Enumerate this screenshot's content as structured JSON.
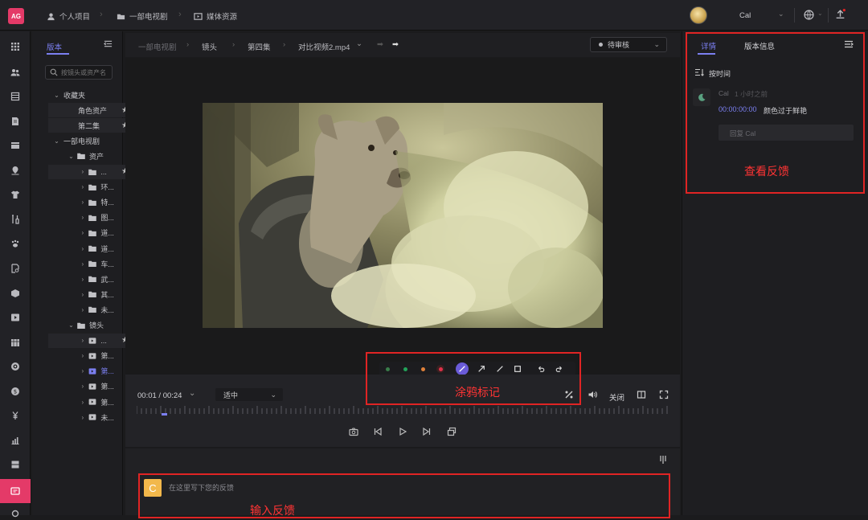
{
  "header": {
    "logo": "AG",
    "breadcrumb": [
      {
        "label": "个人项目",
        "icon": "person-icon"
      },
      {
        "label": "一部电视剧",
        "icon": "folder-icon"
      },
      {
        "label": "媒体资源",
        "icon": "media-icon"
      }
    ],
    "user_name": "Cal"
  },
  "tree": {
    "tab_label": "版本",
    "search_placeholder": "按镜头或资产名",
    "items": [
      {
        "label": "收藏夹",
        "level": 0,
        "chevron": "down"
      },
      {
        "label": "角色资产",
        "level": 1,
        "star": true
      },
      {
        "label": "第二集",
        "level": 1,
        "star": true
      },
      {
        "label": "一部电视剧",
        "level": 0,
        "chevron": "down"
      },
      {
        "label": "资产",
        "level": 1,
        "chevron": "down",
        "folder": true
      },
      {
        "label": "...",
        "level": 2,
        "chevron": "right",
        "folder": true,
        "star": true
      },
      {
        "label": "环...",
        "level": 2,
        "chevron": "right",
        "folder": true
      },
      {
        "label": "特...",
        "level": 2,
        "chevron": "right",
        "folder": true
      },
      {
        "label": "图...",
        "level": 2,
        "chevron": "right",
        "folder": true
      },
      {
        "label": "道...",
        "level": 2,
        "chevron": "right",
        "folder": true
      },
      {
        "label": "道...",
        "level": 2,
        "chevron": "right",
        "folder": true
      },
      {
        "label": "车...",
        "level": 2,
        "chevron": "right",
        "folder": true
      },
      {
        "label": "武...",
        "level": 2,
        "chevron": "right",
        "folder": true
      },
      {
        "label": "其...",
        "level": 2,
        "chevron": "right",
        "folder": true
      },
      {
        "label": "未...",
        "level": 2,
        "chevron": "right",
        "folder": true
      },
      {
        "label": "镜头",
        "level": 1,
        "chevron": "down",
        "folder": true
      },
      {
        "label": "...",
        "level": 2,
        "chevron": "right",
        "film": true,
        "star": true
      },
      {
        "label": "第...",
        "level": 2,
        "chevron": "right",
        "film": true
      },
      {
        "label": "第...",
        "level": 2,
        "chevron": "right",
        "film": true,
        "selected": true
      },
      {
        "label": "第...",
        "level": 2,
        "chevron": "right",
        "film": true
      },
      {
        "label": "第...",
        "level": 2,
        "chevron": "right",
        "film": true
      },
      {
        "label": "未...",
        "level": 2,
        "chevron": "right",
        "film": true
      }
    ]
  },
  "viewer": {
    "breadcrumb": [
      "一部电视剧",
      "镜头",
      "第四集",
      "对比视频2.mp4"
    ],
    "status": "待审核",
    "timecode": "00:01 / 00:24",
    "fit": "适中",
    "close_label": "关闭",
    "doodle_label": "涂鸦标记",
    "tool_colors": [
      "#3a7d4a",
      "#22a35a",
      "#e0813a",
      "#e0304a"
    ],
    "feedback_placeholder": "在这里写下您的反馈",
    "input_label": "输入反馈",
    "feedback_avatar": "C"
  },
  "panel": {
    "tabs": [
      "详情",
      "版本信息"
    ],
    "sort_label": "按时间",
    "comment": {
      "author": "Cal",
      "time": "1 小时之前",
      "timestamp": "00:00:00:00",
      "text": "颜色过于鲜艳",
      "reply_placeholder": "回复 Cal"
    },
    "view_label": "查看反馈"
  },
  "colors": {
    "accent": "#7b7ff0",
    "brand": "#e43a68",
    "annotation_red": "#e02424"
  }
}
